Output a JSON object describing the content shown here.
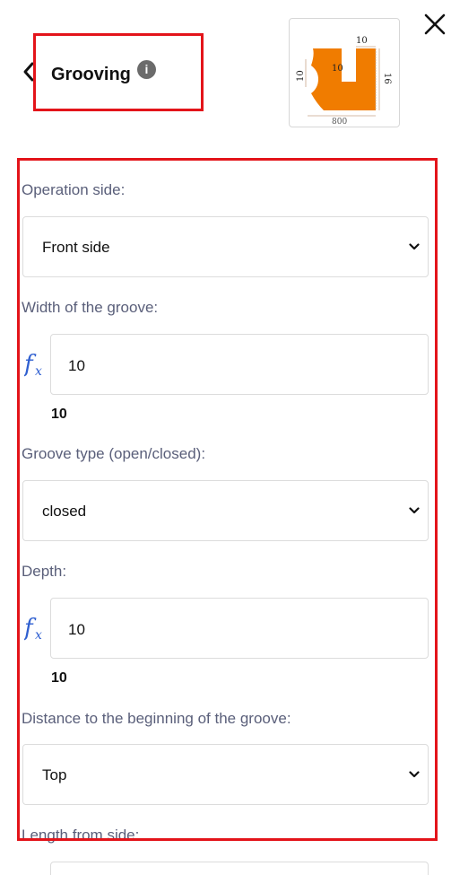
{
  "header": {
    "title": "Grooving",
    "info_icon": "i"
  },
  "preview": {
    "dim_top": "10",
    "dim_inner": "10",
    "dim_left": "10",
    "dim_right": "16",
    "dim_bottom": "800",
    "shape_color": "#f07c00"
  },
  "form": {
    "operation_side": {
      "label": "Operation side:",
      "value": "Front side"
    },
    "groove_width": {
      "label": "Width of the groove:",
      "value": "10",
      "computed": "10"
    },
    "groove_type": {
      "label": "Groove type (open/closed):",
      "value": "closed"
    },
    "depth": {
      "label": "Depth:",
      "value": "10",
      "computed": "10"
    },
    "distance": {
      "label": "Distance to the beginning of the groove:",
      "value": "Top"
    },
    "length_from_side": {
      "label": "Length from side:"
    }
  },
  "colors": {
    "highlight": "#e3141a",
    "fx_icon": "#2f5fd0",
    "label": "#5a5f7a"
  }
}
